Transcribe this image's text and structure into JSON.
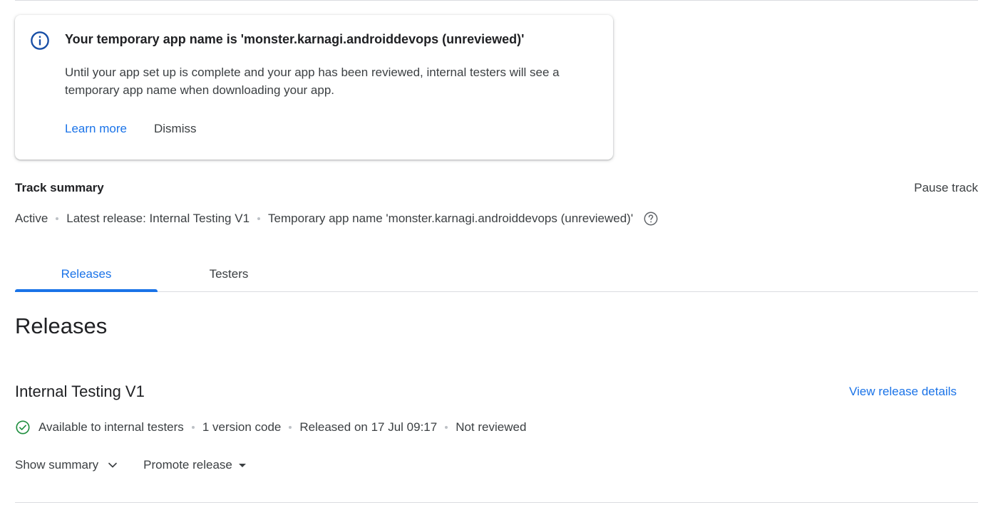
{
  "notice": {
    "title": "Your temporary app name is 'monster.karnagi.androiddevops (unreviewed)'",
    "body": "Until your app set up is complete and your app has been reviewed, internal testers will see a temporary app name when downloading your app.",
    "learn_more": "Learn more",
    "dismiss": "Dismiss",
    "icon": "info-icon"
  },
  "track": {
    "heading": "Track summary",
    "pause_label": "Pause track",
    "status": "Active",
    "latest_release": "Latest release: Internal Testing V1",
    "temp_name": "Temporary app name 'monster.karnagi.androiddevops (unreviewed)'",
    "help_icon": "help-circle-icon"
  },
  "tabs": [
    {
      "label": "Releases",
      "selected": true
    },
    {
      "label": "Testers",
      "selected": false
    }
  ],
  "releases": {
    "heading": "Releases",
    "items": [
      {
        "name": "Internal Testing V1",
        "view_details": "View release details",
        "availability": "Available to internal testers",
        "version_codes": "1 version code",
        "released": "Released on 17 Jul 09:17",
        "review_status": "Not reviewed",
        "show_summary": "Show summary",
        "promote": "Promote release",
        "status_icon": "check-circle-icon"
      }
    ]
  },
  "colors": {
    "accent": "#1a73e8",
    "success": "#1e8e3e",
    "info_icon": "#174ea6",
    "text_primary": "#202124",
    "text_secondary": "#3c4043",
    "divider": "#dadce0"
  }
}
